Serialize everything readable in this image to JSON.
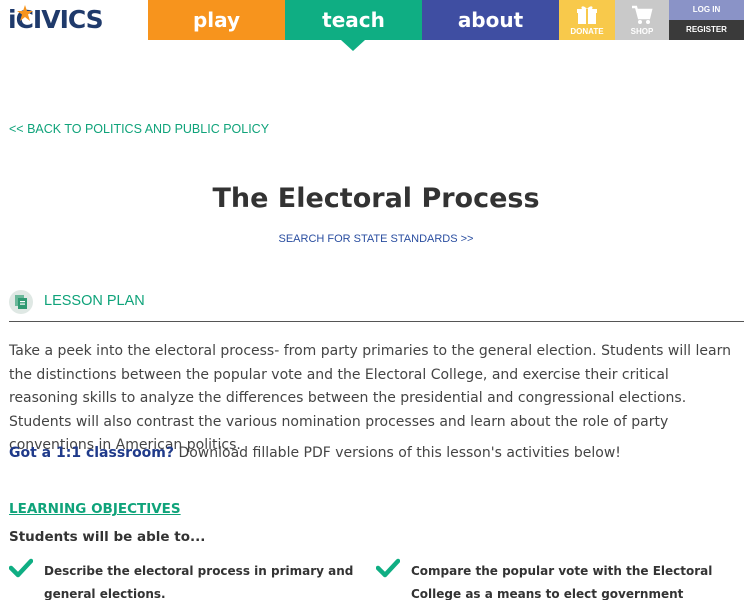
{
  "header": {
    "logo_text": "iCIVICS",
    "nav": {
      "play": "play",
      "teach": "teach",
      "about": "about",
      "donate": "DONATE",
      "shop": "SHOP",
      "login": "LOG IN",
      "register": "REGISTER"
    }
  },
  "main": {
    "back_link": "<< BACK TO POLITICS AND PUBLIC POLICY",
    "title": "The Electoral Process",
    "standards_link": "SEARCH FOR STATE STANDARDS >>",
    "section_label": "LESSON PLAN",
    "description": "Take a peek into the electoral process- from party primaries to the general election. Students will learn the distinctions between the popular vote and the Electoral College, and exercise their critical reasoning skills to analyze the differences between the presidential and congressional elections. Students will also contrast the various nomination processes and learn about the role of party conventions in American politics.",
    "one_to_one_highlight": "Got a 1:1 classroom?",
    "one_to_one_text": " Download fillable PDF versions of this lesson's activities below!",
    "objectives_heading": "LEARNING OBJECTIVES",
    "objectives_subheading": "Students will be able to...",
    "objectives": [
      "Describe the electoral process in primary and general elections.",
      "Compare the popular vote with the Electoral College as a means to elect government officials."
    ]
  },
  "colors": {
    "play": "#f7941d",
    "teach": "#0fae83",
    "about": "#3f4ea2",
    "donate": "#f8c94b",
    "shop": "#c9c9c9",
    "login": "#8a93c7",
    "register": "#3a3a3a",
    "link_green": "#0fa37a",
    "link_blue": "#2a4ea0"
  },
  "icons": {
    "logo_star": "star-icon",
    "donate": "gift-icon",
    "shop": "cart-icon",
    "lesson_plan": "document-icon",
    "objective": "checkmark-icon"
  }
}
